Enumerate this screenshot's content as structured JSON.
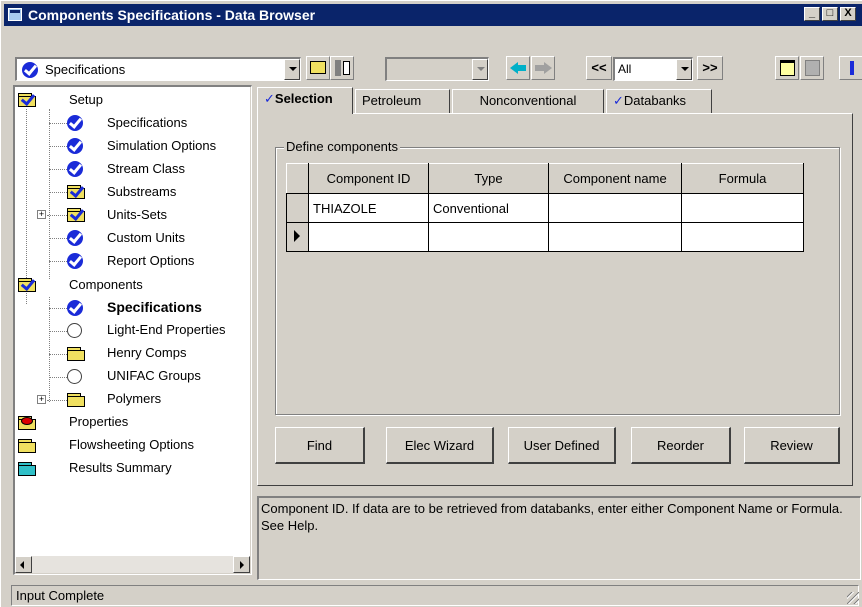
{
  "window": {
    "title": "Components Specifications - Data Browser",
    "minimize": "_",
    "maximize": "□",
    "close": "X"
  },
  "toolbar": {
    "form_select_value": "Specifications",
    "filter_value": "All",
    "prev_label": "<<",
    "next_label": ">>"
  },
  "tree": {
    "setup": "Setup",
    "setup_children": [
      "Specifications",
      "Simulation Options",
      "Stream Class",
      "Substreams",
      "Units-Sets",
      "Custom Units",
      "Report Options"
    ],
    "components": "Components",
    "components_children": [
      "Specifications",
      "Light-End Properties",
      "Henry Comps",
      "UNIFAC Groups",
      "Polymers"
    ],
    "properties": "Properties",
    "flowsheeting": "Flowsheeting Options",
    "results": "Results Summary"
  },
  "tabs": [
    {
      "label": "Selection",
      "checked": true
    },
    {
      "label": "Petroleum",
      "checked": false
    },
    {
      "label": "Nonconventional",
      "checked": false
    },
    {
      "label": "Databanks",
      "checked": true
    }
  ],
  "group": {
    "label": "Define components"
  },
  "grid": {
    "headers": [
      "Component ID",
      "Type",
      "Component name",
      "Formula"
    ],
    "rows": [
      [
        "THIAZOLE",
        "Conventional",
        "",
        ""
      ],
      [
        "",
        "",
        "",
        ""
      ]
    ]
  },
  "buttons": {
    "find": "Find",
    "elec_wizard": "Elec Wizard",
    "user_defined": "User Defined",
    "reorder": "Reorder",
    "review": "Review"
  },
  "help_text": "Component ID. If data are to be retrieved from databanks, enter either Component Name or Formula. See Help.",
  "status_text": "Input Complete",
  "colors": {
    "title_bar": "#0a246a",
    "face": "#d4d0c8",
    "check_blue": "#1a2bd8"
  }
}
